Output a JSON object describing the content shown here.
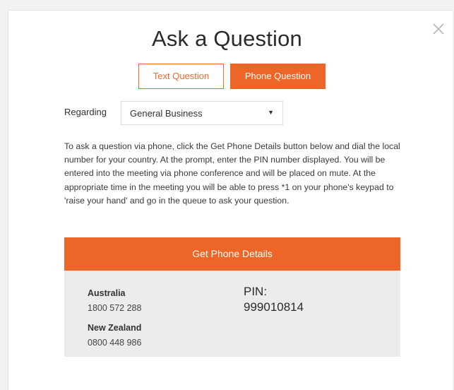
{
  "dialog": {
    "title": "Ask a Question",
    "close_icon": "close-icon"
  },
  "tabs": [
    {
      "label": "Text Question",
      "selected": false
    },
    {
      "label": "Phone Question",
      "selected": true
    }
  ],
  "regarding": {
    "label": "Regarding",
    "selected": "General Business",
    "caret": "▼"
  },
  "instructions": "To ask a question via phone, click the Get Phone Details button below and dial the local number for your country. At the prompt, enter the PIN number displayed. You will be entered into the meeting via phone conference and will be placed on mute. At the appropriate time in the meeting you will be able to press *1 on your phone's keypad to 'raise your hand' and go in the queue to ask your question.",
  "get_phone_button": "Get Phone Details",
  "phone_numbers": [
    {
      "country": "Australia",
      "number": "1800 572 288"
    },
    {
      "country": "New Zealand",
      "number": "0800 448 986"
    }
  ],
  "pin": {
    "label": "PIN:",
    "value": "999010814"
  },
  "colors": {
    "accent": "#ee6627",
    "details_bg": "#ececec"
  }
}
